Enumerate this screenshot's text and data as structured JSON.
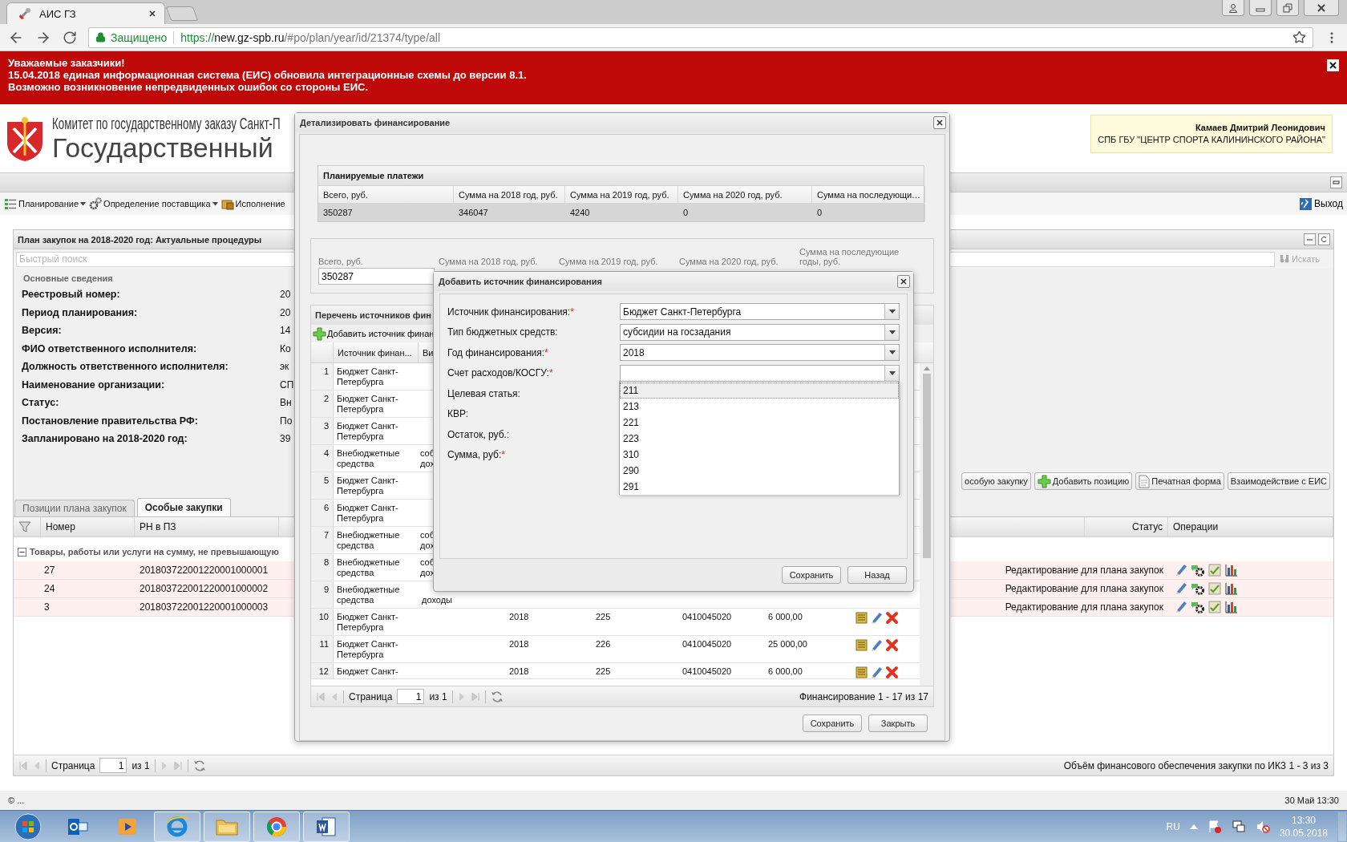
{
  "browser": {
    "tab_title": "АИС ГЗ",
    "secure_label": "Защищено",
    "url_scheme": "https://",
    "url_host": "new.gz-spb.ru",
    "url_path": "/#po/plan/year/id/21374/type/all"
  },
  "banner": {
    "lines": [
      "Уважаемые заказчики!",
      "15.04.2018 единая информационная система (ЕИС) обновила интеграционные схемы до версии 8.1.",
      "Возможно возникновение непредвиденных ошибок со стороны ЕИС."
    ]
  },
  "header": {
    "org_title": "Комитет по государственному заказу Санкт-П",
    "system_title": "Государственный",
    "user_name": "Камаев Дмитрий Леонидович",
    "user_org": "СПБ ГБУ \"ЦЕНТР СПОРТА КАЛИНИНСКОГО РАЙОНА\""
  },
  "menu": {
    "items": [
      {
        "kind": "planning",
        "label": "Планирование",
        "dropdown": true
      },
      {
        "kind": "supplier",
        "label": "Определение поставщика",
        "dropdown": true
      },
      {
        "kind": "execution",
        "label": "Исполнение",
        "dropdown": false
      }
    ],
    "exit_label": "Выход"
  },
  "panel": {
    "title": "План закупок на 2018-2020 год: Актуальные процедуры",
    "search_placeholder": "Быстрый поиск",
    "search_button": "Искать",
    "section_title": "Основные сведения",
    "fields": [
      {
        "label": "Реестровый номер:",
        "value": "20"
      },
      {
        "label": "Период планирования:",
        "value": "20"
      },
      {
        "label": "Версия:",
        "value": "14"
      },
      {
        "label": "ФИО ответственного исполнителя:",
        "value": "Ко"
      },
      {
        "label": "Должность ответственного исполнителя:",
        "value": "эк"
      },
      {
        "label": "Наименование организации:",
        "value": "СП"
      },
      {
        "label": "Статус:",
        "value": "Вн"
      },
      {
        "label": "Постановление правительства РФ:",
        "value": "По"
      },
      {
        "label": "Запланировано на 2018-2020 год:",
        "value": "39"
      }
    ],
    "actions": [
      {
        "kind": "plain",
        "label": "особую закупку"
      },
      {
        "kind": "add",
        "label": "Добавить позицию"
      },
      {
        "kind": "print",
        "label": "Печатная форма"
      },
      {
        "kind": "plain",
        "label": "Взаимодействие с ЕИС"
      }
    ],
    "tabs": [
      {
        "label": "Позиции плана закупок",
        "selected": false
      },
      {
        "label": "Особые закупки",
        "selected": true
      }
    ],
    "columns": {
      "number": "Номер",
      "rn": "РН в ПЗ",
      "status": "Статус",
      "operations": "Операции"
    },
    "group": {
      "label": "Товары, работы или услуги на сумму, не превышающую",
      "expanded": true
    },
    "rows": [
      {
        "number": "27",
        "rn": "201803722001220001000001",
        "status": "Редактирование для плана закупок"
      },
      {
        "number": "24",
        "rn": "201803722001220001000002",
        "status": "Редактирование для плана закупок"
      },
      {
        "number": "3",
        "rn": "201803722001220001000003",
        "status": "Редактирование для плана закупок"
      }
    ],
    "pager": {
      "page_label": "Страница",
      "page": "1",
      "of": "из 1",
      "summary": "Объём финансового обеспечения закупки по ИКЗ 1 - 3 из 3"
    }
  },
  "status_bar": {
    "left": "© ...",
    "right": "30 Май 13:30"
  },
  "taskbar": {
    "lang": "RU",
    "time": "13:30",
    "date": "30.05.2018"
  },
  "finance_dialog": {
    "title": "Детализировать финансирование",
    "planned": {
      "title": "Планируемые платежи",
      "columns": [
        "Всего, руб.",
        "Сумма на 2018 год, руб.",
        "Сумма на 2019 год, руб.",
        "Сумма на 2020 год, руб.",
        "Сумма на последующи…"
      ],
      "row": [
        "350287",
        "346047",
        "4240",
        "0",
        "0"
      ],
      "selected": true
    },
    "totals": {
      "labels": [
        "Всего, руб.",
        "Сумма на 2018 год, руб.",
        "Сумма на 2019 год, руб.",
        "Сумма на 2020 год, руб.",
        "Сумма на последующие годы, руб."
      ],
      "total_value": "350287"
    },
    "sources": {
      "title": "Перечень источников фин",
      "add_button": "Добавить источник финан",
      "columns": [
        "Источник финан...",
        "Ви"
      ],
      "rows": [
        {
          "kind": "covered",
          "n": "1",
          "source": "Бюджет Санкт-Петербурга"
        },
        {
          "kind": "covered",
          "n": "2",
          "source": "Бюджет Санкт-Петербурга"
        },
        {
          "kind": "covered",
          "n": "3",
          "source": "Бюджет Санкт-Петербурга"
        },
        {
          "kind": "covered",
          "n": "4",
          "source": "Внебюджетные средства",
          "vid": "соб дох"
        },
        {
          "kind": "covered",
          "n": "5",
          "source": "Бюджет Санкт-Петербурга"
        },
        {
          "kind": "covered",
          "n": "6",
          "source": "Бюджет Санкт-Петербурга"
        },
        {
          "kind": "covered",
          "n": "7",
          "source": "Внебюджетные средства",
          "vid": "соб дох"
        },
        {
          "kind": "covered",
          "n": "8",
          "source": "Внебюджетные средства",
          "vid": "соб дох"
        },
        {
          "kind": "partial",
          "n": "9",
          "source": "Внебюджетные средства",
          "vid": "доходы"
        },
        {
          "kind": "full",
          "n": "10",
          "source": "Бюджет Санкт-Петербурга",
          "year": "2018",
          "kosgu": "225",
          "kcs": "0410045020",
          "sum": "6 000,00"
        },
        {
          "kind": "full",
          "n": "11",
          "source": "Бюджет Санкт-Петербурга",
          "year": "2018",
          "kosgu": "226",
          "kcs": "0410045020",
          "sum": "25 000,00"
        },
        {
          "kind": "full",
          "n": "12",
          "source": "Бюджет Санкт-",
          "year": "2018",
          "kosgu": "225",
          "kcs": "0410045020",
          "sum": "6 000,00"
        }
      ],
      "pager": {
        "page_label": "Страница",
        "page": "1",
        "of": "из 1",
        "summary": "Финансирование 1 - 17 из 17"
      }
    },
    "buttons": [
      "Сохранить",
      "Закрыть"
    ]
  },
  "source_dialog": {
    "title": "Добавить источник финансирования",
    "required_mark": "*",
    "fields": [
      {
        "kind": "combo",
        "label": "Источник финансирования:",
        "required": true,
        "value": "Бюджет Санкт-Петербурга"
      },
      {
        "kind": "combo",
        "label": "Тип бюджетных средств:",
        "required": false,
        "value": "субсидии на госзадания"
      },
      {
        "kind": "combo",
        "label": "Год финансирования:",
        "required": true,
        "value": "2018"
      },
      {
        "kind": "combo",
        "label": "Счет расходов/КОСГУ:",
        "required": true
      },
      {
        "kind": "text",
        "label": "Целевая статья:",
        "required": false
      },
      {
        "kind": "text",
        "label": "КВР:",
        "required": false
      },
      {
        "kind": "text",
        "label": "Остаток, руб.:",
        "required": false
      },
      {
        "kind": "text",
        "label": "Сумма, руб:",
        "required": true
      }
    ],
    "dropdown": {
      "options": [
        {
          "label": "211",
          "selected": true
        },
        {
          "label": "213",
          "selected": false
        },
        {
          "label": "221",
          "selected": false
        },
        {
          "label": "223",
          "selected": false
        },
        {
          "label": "310",
          "selected": false
        },
        {
          "label": "290",
          "selected": false
        },
        {
          "label": "291",
          "selected": false
        }
      ]
    },
    "buttons": [
      "Сохранить",
      "Назад"
    ]
  }
}
